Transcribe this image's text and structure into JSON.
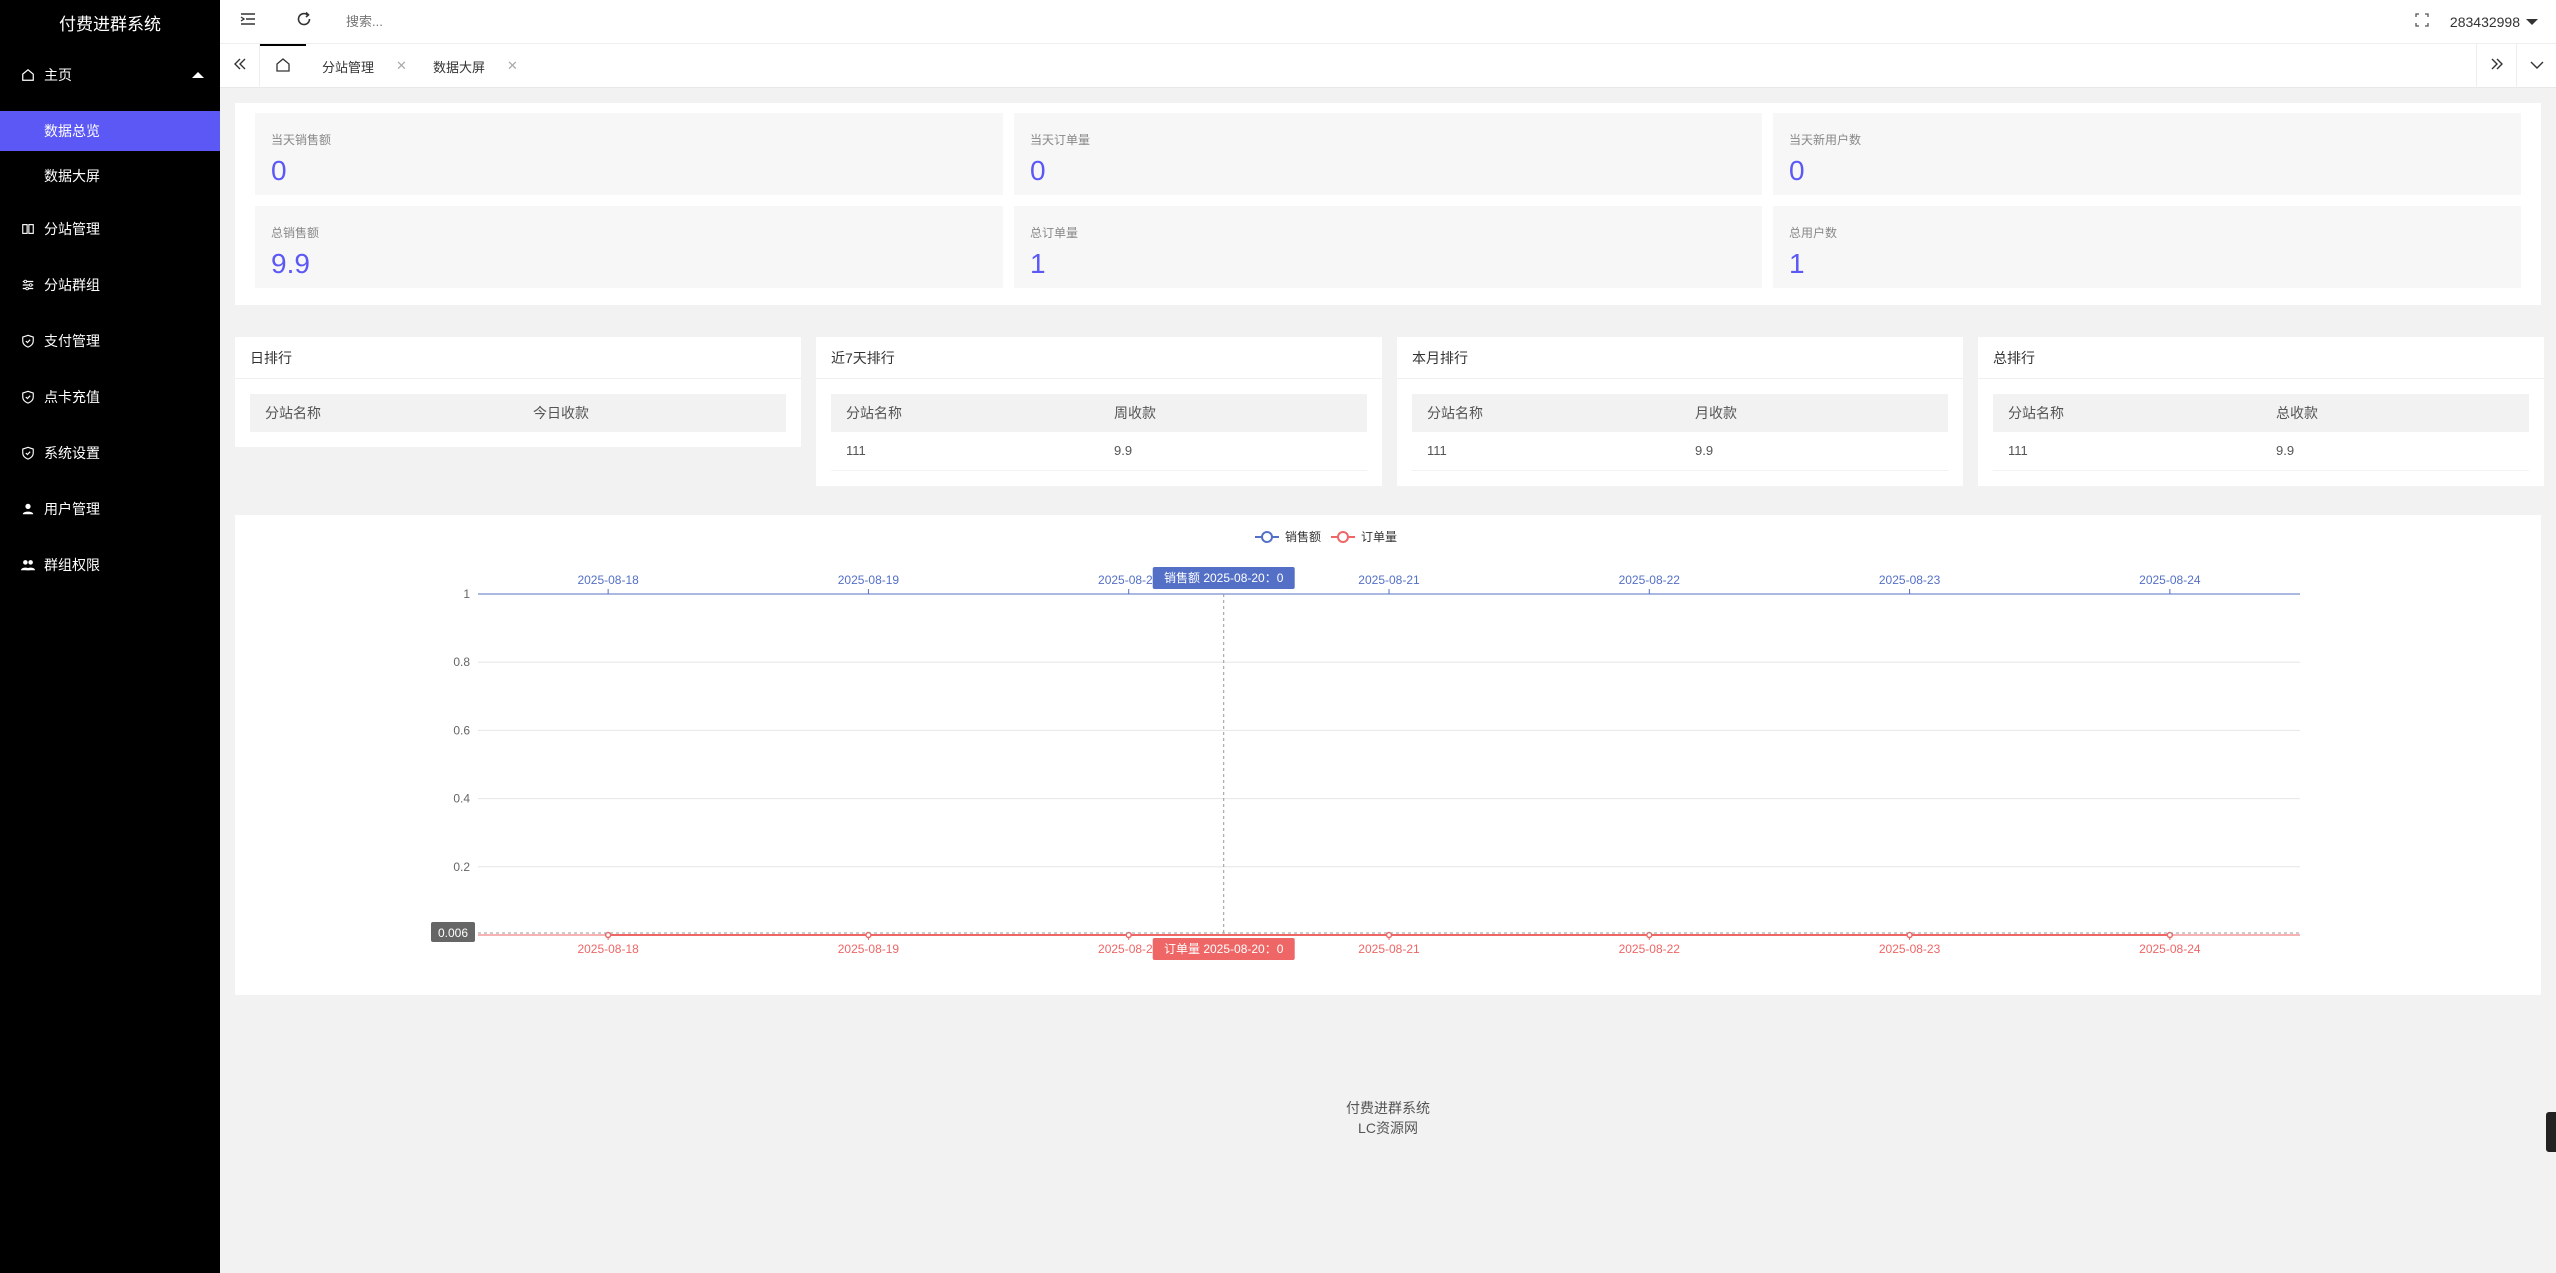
{
  "brand": "付费进群系统",
  "sidebar": {
    "home": {
      "label": "主页",
      "icon": "home-icon"
    },
    "sub": [
      {
        "label": "数据总览",
        "active": true
      },
      {
        "label": "数据大屏",
        "active": false
      }
    ],
    "items": [
      {
        "label": "分站管理",
        "icon": "columns-icon"
      },
      {
        "label": "分站群组",
        "icon": "sliders-icon"
      },
      {
        "label": "支付管理",
        "icon": "shield-check-icon"
      },
      {
        "label": "点卡充值",
        "icon": "shield-check-icon"
      },
      {
        "label": "系统设置",
        "icon": "shield-check-icon"
      },
      {
        "label": "用户管理",
        "icon": "user-icon"
      },
      {
        "label": "群组权限",
        "icon": "users-icon"
      }
    ]
  },
  "header": {
    "search_placeholder": "搜索...",
    "username": "283432998"
  },
  "tabs": [
    {
      "label": "分站管理"
    },
    {
      "label": "数据大屏"
    }
  ],
  "stats": [
    {
      "label": "当天销售额",
      "value": "0"
    },
    {
      "label": "当天订单量",
      "value": "0"
    },
    {
      "label": "当天新用户数",
      "value": "0"
    },
    {
      "label": "总销售额",
      "value": "9.9"
    },
    {
      "label": "总订单量",
      "value": "1"
    },
    {
      "label": "总用户数",
      "value": "1"
    }
  ],
  "rankings": [
    {
      "title": "日排行",
      "columns": [
        "分站名称",
        "今日收款"
      ],
      "rows": []
    },
    {
      "title": "近7天排行",
      "columns": [
        "分站名称",
        "周收款"
      ],
      "rows": [
        [
          "111",
          "9.9"
        ]
      ]
    },
    {
      "title": "本月排行",
      "columns": [
        "分站名称",
        "月收款"
      ],
      "rows": [
        [
          "111",
          "9.9"
        ]
      ]
    },
    {
      "title": "总排行",
      "columns": [
        "分站名称",
        "总收款"
      ],
      "rows": [
        [
          "111",
          "9.9"
        ]
      ]
    }
  ],
  "chart_data": {
    "type": "line",
    "x": [
      "2025-08-18",
      "2025-08-19",
      "2025-08-20",
      "2025-08-21",
      "2025-08-22",
      "2025-08-23",
      "2025-08-24"
    ],
    "series": [
      {
        "name": "销售额",
        "values": [
          0,
          0,
          0,
          0,
          0,
          0,
          0
        ],
        "color": "#5470c6"
      },
      {
        "name": "订单量",
        "values": [
          0,
          0,
          0,
          0,
          0,
          0,
          0
        ],
        "color": "#ee6666"
      }
    ],
    "yticks": [
      "1",
      "0.8",
      "0.6",
      "0.4",
      "0.2"
    ],
    "ylim": [
      0,
      1
    ],
    "legend_position": "top-center",
    "grid": true,
    "pointer": {
      "y_readout": "0.006",
      "x_index": 2,
      "tooltip_top": "销售额  2025-08-20：0",
      "tooltip_bottom": "订单量  2025-08-20：0"
    }
  },
  "footer": {
    "line1": "付费进群系统",
    "line2": "LC资源网"
  },
  "colors": {
    "accent": "#5b58f5",
    "sales": "#5470c6",
    "orders": "#ee6666"
  }
}
